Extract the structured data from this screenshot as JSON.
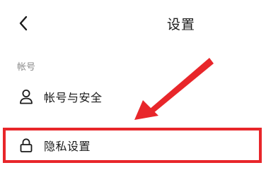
{
  "header": {
    "title": "设置"
  },
  "icons": {
    "back": "chevron-left-icon",
    "account": "user-icon",
    "privacy": "lock-icon"
  },
  "sections": {
    "account_section_label": "帐号",
    "items": [
      {
        "label": "帐号与安全"
      },
      {
        "label": "隐私设置"
      }
    ]
  },
  "annotation": {
    "highlight_color": "#e8262a",
    "arrow_color": "#e8262a"
  }
}
